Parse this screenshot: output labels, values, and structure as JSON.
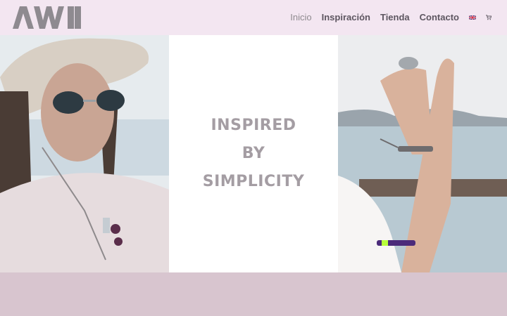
{
  "brand": {
    "logo_text": "AWI"
  },
  "nav": {
    "items": [
      {
        "label": "Inicio",
        "active": true
      },
      {
        "label": "Inspiración",
        "active": false
      },
      {
        "label": "Tienda",
        "active": false
      },
      {
        "label": "Contacto",
        "active": false
      }
    ],
    "language_icon": "uk-flag-icon",
    "cart_icon": "shopping-cart-icon"
  },
  "hero": {
    "tagline_lines": [
      "INSPIRED",
      "BY",
      "SIMPLICITY"
    ]
  },
  "colors": {
    "header_bg": "#f3e6f1",
    "footer_band": "#d8c5cf",
    "tagline": "#a49da3",
    "nav_text": "#5d5660"
  }
}
